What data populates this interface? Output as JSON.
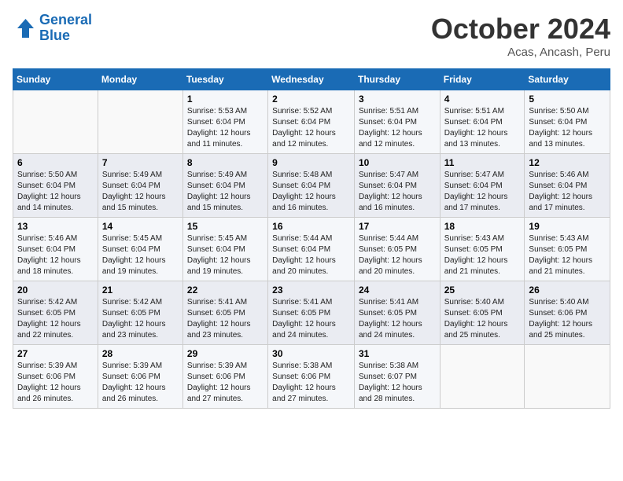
{
  "header": {
    "logo_line1": "General",
    "logo_line2": "Blue",
    "month": "October 2024",
    "location": "Acas, Ancash, Peru"
  },
  "weekdays": [
    "Sunday",
    "Monday",
    "Tuesday",
    "Wednesday",
    "Thursday",
    "Friday",
    "Saturday"
  ],
  "weeks": [
    [
      {
        "day": "",
        "detail": ""
      },
      {
        "day": "",
        "detail": ""
      },
      {
        "day": "1",
        "detail": "Sunrise: 5:53 AM\nSunset: 6:04 PM\nDaylight: 12 hours and 11 minutes."
      },
      {
        "day": "2",
        "detail": "Sunrise: 5:52 AM\nSunset: 6:04 PM\nDaylight: 12 hours and 12 minutes."
      },
      {
        "day": "3",
        "detail": "Sunrise: 5:51 AM\nSunset: 6:04 PM\nDaylight: 12 hours and 12 minutes."
      },
      {
        "day": "4",
        "detail": "Sunrise: 5:51 AM\nSunset: 6:04 PM\nDaylight: 12 hours and 13 minutes."
      },
      {
        "day": "5",
        "detail": "Sunrise: 5:50 AM\nSunset: 6:04 PM\nDaylight: 12 hours and 13 minutes."
      }
    ],
    [
      {
        "day": "6",
        "detail": "Sunrise: 5:50 AM\nSunset: 6:04 PM\nDaylight: 12 hours and 14 minutes."
      },
      {
        "day": "7",
        "detail": "Sunrise: 5:49 AM\nSunset: 6:04 PM\nDaylight: 12 hours and 15 minutes."
      },
      {
        "day": "8",
        "detail": "Sunrise: 5:49 AM\nSunset: 6:04 PM\nDaylight: 12 hours and 15 minutes."
      },
      {
        "day": "9",
        "detail": "Sunrise: 5:48 AM\nSunset: 6:04 PM\nDaylight: 12 hours and 16 minutes."
      },
      {
        "day": "10",
        "detail": "Sunrise: 5:47 AM\nSunset: 6:04 PM\nDaylight: 12 hours and 16 minutes."
      },
      {
        "day": "11",
        "detail": "Sunrise: 5:47 AM\nSunset: 6:04 PM\nDaylight: 12 hours and 17 minutes."
      },
      {
        "day": "12",
        "detail": "Sunrise: 5:46 AM\nSunset: 6:04 PM\nDaylight: 12 hours and 17 minutes."
      }
    ],
    [
      {
        "day": "13",
        "detail": "Sunrise: 5:46 AM\nSunset: 6:04 PM\nDaylight: 12 hours and 18 minutes."
      },
      {
        "day": "14",
        "detail": "Sunrise: 5:45 AM\nSunset: 6:04 PM\nDaylight: 12 hours and 19 minutes."
      },
      {
        "day": "15",
        "detail": "Sunrise: 5:45 AM\nSunset: 6:04 PM\nDaylight: 12 hours and 19 minutes."
      },
      {
        "day": "16",
        "detail": "Sunrise: 5:44 AM\nSunset: 6:04 PM\nDaylight: 12 hours and 20 minutes."
      },
      {
        "day": "17",
        "detail": "Sunrise: 5:44 AM\nSunset: 6:05 PM\nDaylight: 12 hours and 20 minutes."
      },
      {
        "day": "18",
        "detail": "Sunrise: 5:43 AM\nSunset: 6:05 PM\nDaylight: 12 hours and 21 minutes."
      },
      {
        "day": "19",
        "detail": "Sunrise: 5:43 AM\nSunset: 6:05 PM\nDaylight: 12 hours and 21 minutes."
      }
    ],
    [
      {
        "day": "20",
        "detail": "Sunrise: 5:42 AM\nSunset: 6:05 PM\nDaylight: 12 hours and 22 minutes."
      },
      {
        "day": "21",
        "detail": "Sunrise: 5:42 AM\nSunset: 6:05 PM\nDaylight: 12 hours and 23 minutes."
      },
      {
        "day": "22",
        "detail": "Sunrise: 5:41 AM\nSunset: 6:05 PM\nDaylight: 12 hours and 23 minutes."
      },
      {
        "day": "23",
        "detail": "Sunrise: 5:41 AM\nSunset: 6:05 PM\nDaylight: 12 hours and 24 minutes."
      },
      {
        "day": "24",
        "detail": "Sunrise: 5:41 AM\nSunset: 6:05 PM\nDaylight: 12 hours and 24 minutes."
      },
      {
        "day": "25",
        "detail": "Sunrise: 5:40 AM\nSunset: 6:05 PM\nDaylight: 12 hours and 25 minutes."
      },
      {
        "day": "26",
        "detail": "Sunrise: 5:40 AM\nSunset: 6:06 PM\nDaylight: 12 hours and 25 minutes."
      }
    ],
    [
      {
        "day": "27",
        "detail": "Sunrise: 5:39 AM\nSunset: 6:06 PM\nDaylight: 12 hours and 26 minutes."
      },
      {
        "day": "28",
        "detail": "Sunrise: 5:39 AM\nSunset: 6:06 PM\nDaylight: 12 hours and 26 minutes."
      },
      {
        "day": "29",
        "detail": "Sunrise: 5:39 AM\nSunset: 6:06 PM\nDaylight: 12 hours and 27 minutes."
      },
      {
        "day": "30",
        "detail": "Sunrise: 5:38 AM\nSunset: 6:06 PM\nDaylight: 12 hours and 27 minutes."
      },
      {
        "day": "31",
        "detail": "Sunrise: 5:38 AM\nSunset: 6:07 PM\nDaylight: 12 hours and 28 minutes."
      },
      {
        "day": "",
        "detail": ""
      },
      {
        "day": "",
        "detail": ""
      }
    ]
  ]
}
